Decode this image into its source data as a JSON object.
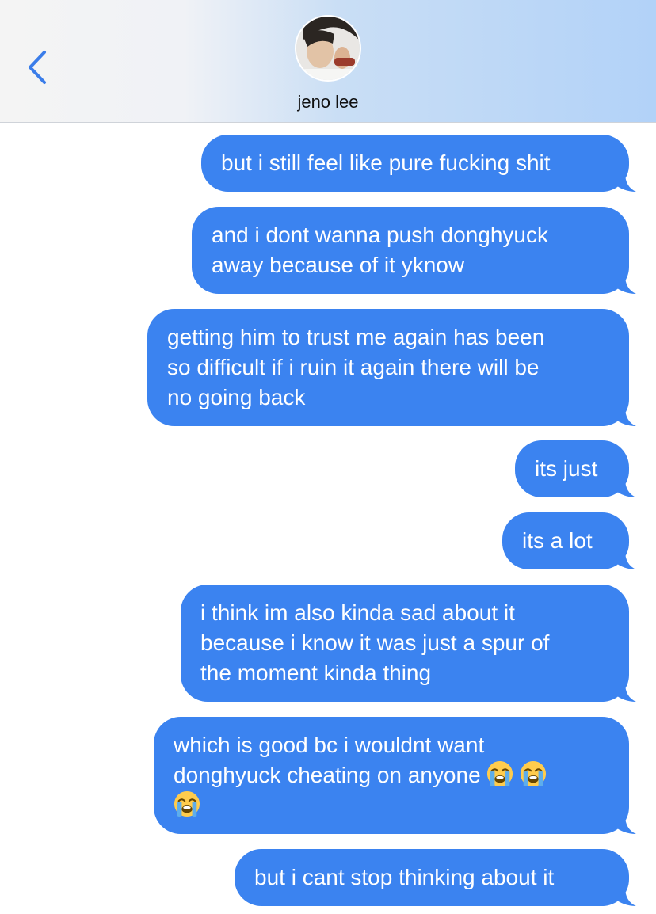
{
  "header": {
    "back_icon": "chevron-left-icon",
    "contact_name": "jeno lee",
    "accent_color": "#3b83f0"
  },
  "messages": [
    {
      "text": "but i still feel like pure fucking shit"
    },
    {
      "text": "and i dont wanna push donghyuck\naway because of it yknow"
    },
    {
      "text": "getting him to trust me again has been\nso difficult if i ruin it again there will be\nno going back"
    },
    {
      "text": "its just"
    },
    {
      "text": "its a lot"
    },
    {
      "text": "i think im also kinda sad about it\nbecause i know it was just a spur of\nthe moment kinda thing"
    },
    {
      "text_line1": "which is good bc i wouldnt want",
      "text_line2": "donghyuck cheating on anyone",
      "emojis": [
        "loudly-crying-face-icon",
        "loudly-crying-face-icon",
        "loudly-crying-face-icon"
      ]
    },
    {
      "text": "but i cant stop thinking about it"
    }
  ]
}
